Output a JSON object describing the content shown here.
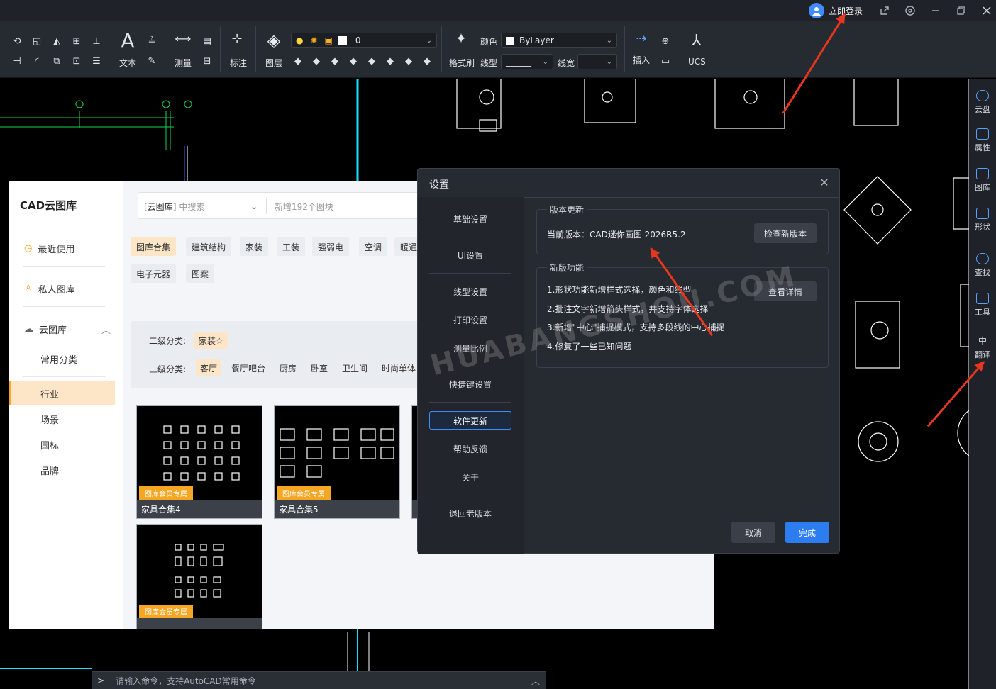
{
  "titlebar": {
    "login_label": "立即登录"
  },
  "ribbon": {
    "text_label": "文本",
    "measure_label": "测量",
    "annotate_label": "标注",
    "layer_label": "图层",
    "layer_value": "0",
    "color_label": "颜色",
    "color_value": "ByLayer",
    "format_brush_label": "格式刷",
    "linetype_label": "线型",
    "linetype_value": "______",
    "linewidth_label": "线宽",
    "linewidth_value": "——",
    "insert_label": "插入",
    "ucs_label": "UCS"
  },
  "rightbar": {
    "items": [
      {
        "label": "云盘",
        "icon": "cloud-icon"
      },
      {
        "label": "属性",
        "icon": "properties-icon"
      },
      {
        "label": "图库",
        "icon": "gallery-icon"
      },
      {
        "label": "形状",
        "icon": "shape-icon"
      },
      {
        "label": "查找",
        "icon": "find-icon"
      },
      {
        "label": "工具",
        "icon": "toolbox-icon"
      },
      {
        "label": "翻译",
        "icon": "translate-icon"
      }
    ],
    "translate_glyph": "中"
  },
  "library": {
    "title": "CAD云图库",
    "search_scope": "[云图库]",
    "search_scope_hint": "中搜索",
    "search_placeholder": "新增192个图块",
    "nav": [
      {
        "label": "最近使用"
      },
      {
        "label": "私人图库"
      },
      {
        "label": "云图库"
      },
      {
        "label": "常用分类"
      },
      {
        "label": "行业"
      },
      {
        "label": "场景"
      },
      {
        "label": "国标"
      },
      {
        "label": "品牌"
      }
    ],
    "categories": [
      "图库合集",
      "建筑结构",
      "家装",
      "工装",
      "强弱电",
      "空调",
      "暖通",
      "电子元器",
      "图案"
    ],
    "level2_label": "二级分类:",
    "level2_value": "家装☆",
    "level3_label": "三级分类:",
    "level3": [
      "客厅",
      "餐厅吧台",
      "厨房",
      "卧室",
      "卫生间",
      "时尚单体"
    ],
    "member_badge": "图库会员专属",
    "cards": [
      {
        "caption": "家具合集4"
      },
      {
        "caption": "家具合集5"
      },
      {
        "caption": ""
      },
      {
        "caption": ""
      }
    ]
  },
  "settings": {
    "title": "设置",
    "nav": [
      "基础设置",
      "UI设置",
      "线型设置",
      "打印设置",
      "测量比例",
      "快捷键设置",
      "软件更新",
      "帮助反馈",
      "关于",
      "退回老版本"
    ],
    "version_group_title": "版本更新",
    "current_version": "当前版本：CAD迷你画图 2026R5.2",
    "check_button": "检查新版本",
    "features_group_title": "新版功能",
    "features": [
      "1.形状功能新增样式选择，颜色和线型",
      "2.批注文字新增箭头样式，并支持字体选择",
      "3.新增\"中心\"捕捉模式，支持多段线的中心捕捉",
      "4.修复了一些已知问题"
    ],
    "details_button": "查看详情",
    "cancel_button": "取消",
    "ok_button": "完成"
  },
  "watermark": "HUABANGSHOU.COM",
  "command": {
    "prompt": ">_",
    "placeholder": "请输入命令，支持AutoCAD常用命令"
  },
  "colors": {
    "accent": "#2d7cf0",
    "highlight": "#f5a623",
    "arrow": "#e8361e"
  }
}
